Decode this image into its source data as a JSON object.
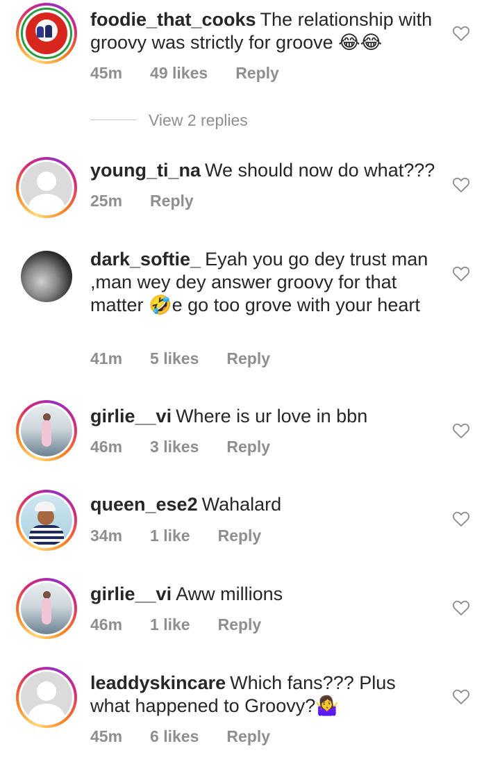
{
  "comments": [
    {
      "username": "foodie_that_cooks",
      "text": "The relationship with groovy was strictly for groove 😂😂",
      "time": "45m",
      "likes": "49 likes",
      "reply": "Reply",
      "view_replies": "View 2 replies",
      "avatar_icon": "organization-logo-icon"
    },
    {
      "username": "young_ti_na",
      "text": "We should now do what???",
      "time": "25m",
      "likes": "",
      "reply": "Reply",
      "avatar_icon": "default-avatar-icon"
    },
    {
      "username": "dark_softie_",
      "text": "Eyah you go dey trust man ,man wey dey answer groovy for that matter 🤣e go too grove with your heart",
      "time": "41m",
      "likes": "5 likes",
      "reply": "Reply",
      "avatar_icon": "user-photo-icon"
    },
    {
      "username": "girlie__vi",
      "text": "Where is ur love in bbn",
      "time": "46m",
      "likes": "3 likes",
      "reply": "Reply",
      "avatar_icon": "user-photo-icon"
    },
    {
      "username": "queen_ese2",
      "text": "Wahalard",
      "time": "34m",
      "likes": "1 like",
      "reply": "Reply",
      "avatar_icon": "user-photo-icon"
    },
    {
      "username": "girlie__vi",
      "text": "Aww millions",
      "time": "46m",
      "likes": "1 like",
      "reply": "Reply",
      "avatar_icon": "user-photo-icon"
    },
    {
      "username": "leaddyskincare",
      "text": "Which fans??? Plus what happened to Groovy?🤷‍♀️",
      "time": "45m",
      "likes": "6 likes",
      "reply": "Reply",
      "avatar_icon": "default-avatar-icon"
    }
  ],
  "colors": {
    "text": "#262626",
    "meta": "#8e8e8e",
    "story_ring": "#d62976"
  }
}
